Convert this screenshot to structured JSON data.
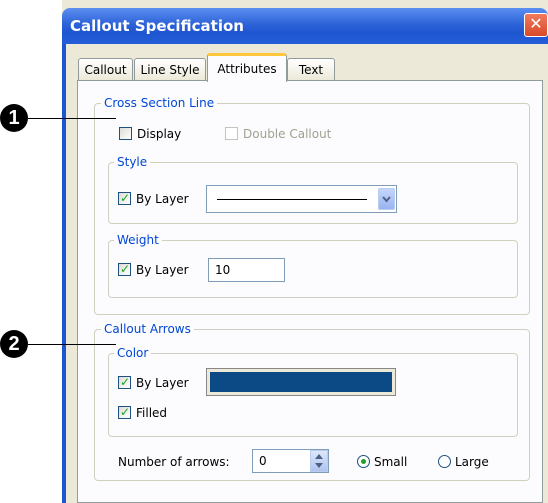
{
  "dialog": {
    "title": "Callout Specification",
    "close_label": "✕"
  },
  "tabs": [
    {
      "label": "Callout"
    },
    {
      "label": "Line Style"
    },
    {
      "label": "Attributes",
      "active": true
    },
    {
      "label": "Text"
    }
  ],
  "cross_section": {
    "legend": "Cross Section Line",
    "display": {
      "label": "Display",
      "checked": false
    },
    "double_callout": {
      "label": "Double Callout",
      "checked": false,
      "disabled": true
    },
    "style": {
      "legend": "Style",
      "by_layer": {
        "label": "By Layer",
        "checked": true
      }
    },
    "weight": {
      "legend": "Weight",
      "by_layer": {
        "label": "By Layer",
        "checked": true
      },
      "value": "10"
    }
  },
  "callout_arrows": {
    "legend": "Callout Arrows",
    "color": {
      "legend": "Color",
      "by_layer": {
        "label": "By Layer",
        "checked": true
      },
      "swatch_color": "#0c4a86"
    },
    "filled": {
      "label": "Filled",
      "checked": true
    },
    "number_label": "Number of arrows:",
    "number_value": "0",
    "size_small": {
      "label": "Small",
      "selected": true
    },
    "size_large": {
      "label": "Large",
      "selected": false
    }
  },
  "callouts": [
    {
      "number": "1"
    },
    {
      "number": "2"
    }
  ],
  "colors": {
    "accent_title": "#1e55d0",
    "group_legend": "#0046d5",
    "check_mark": "#21a121"
  }
}
